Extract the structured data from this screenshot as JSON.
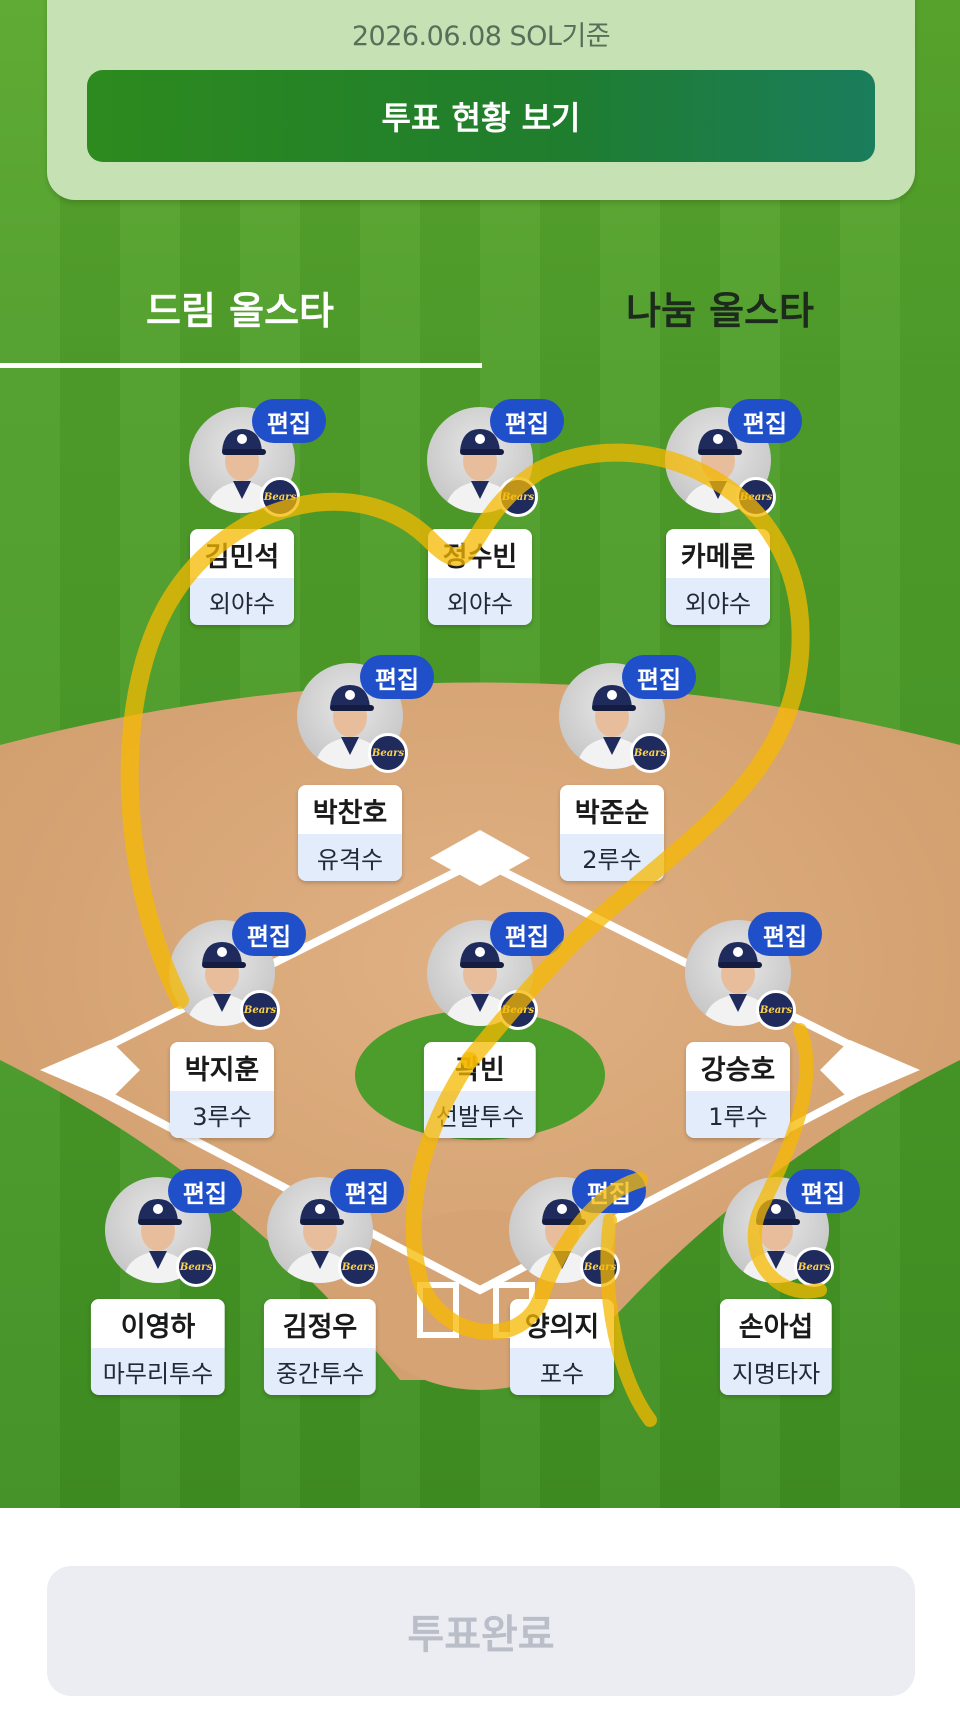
{
  "info_card": {
    "date_text": "2026.06.08 SOL기준",
    "vote_status_button": "투표 현황 보기"
  },
  "tabs": [
    {
      "label": "드림 올스타",
      "active": true
    },
    {
      "label": "나눔 올스타",
      "active": false
    }
  ],
  "edit_label": "편집",
  "team_logo_text": "Bears",
  "players": [
    {
      "name": "김민석",
      "position": "외야수"
    },
    {
      "name": "정수빈",
      "position": "외야수"
    },
    {
      "name": "카메론",
      "position": "외야수"
    },
    {
      "name": "박찬호",
      "position": "유격수"
    },
    {
      "name": "박준순",
      "position": "2루수"
    },
    {
      "name": "박지훈",
      "position": "3루수"
    },
    {
      "name": "곽빈",
      "position": "선발투수"
    },
    {
      "name": "강승호",
      "position": "1루수"
    },
    {
      "name": "이영하",
      "position": "마무리투수"
    },
    {
      "name": "김정우",
      "position": "중간투수"
    },
    {
      "name": "양의지",
      "position": "포수"
    },
    {
      "name": "손아섭",
      "position": "지명타자"
    }
  ],
  "bottom": {
    "vote_complete_button": "투표완료"
  },
  "colors": {
    "field_green": "#4f9e2a",
    "infield_dirt": "#d9a878",
    "edit_badge": "#1f4fc9",
    "position_bg": "#e3ecfa",
    "card_bg": "#c6e1b3",
    "primary_button": "#2d8a1e",
    "disabled_button": "#ebedf2",
    "scribble": "#f5b800"
  }
}
